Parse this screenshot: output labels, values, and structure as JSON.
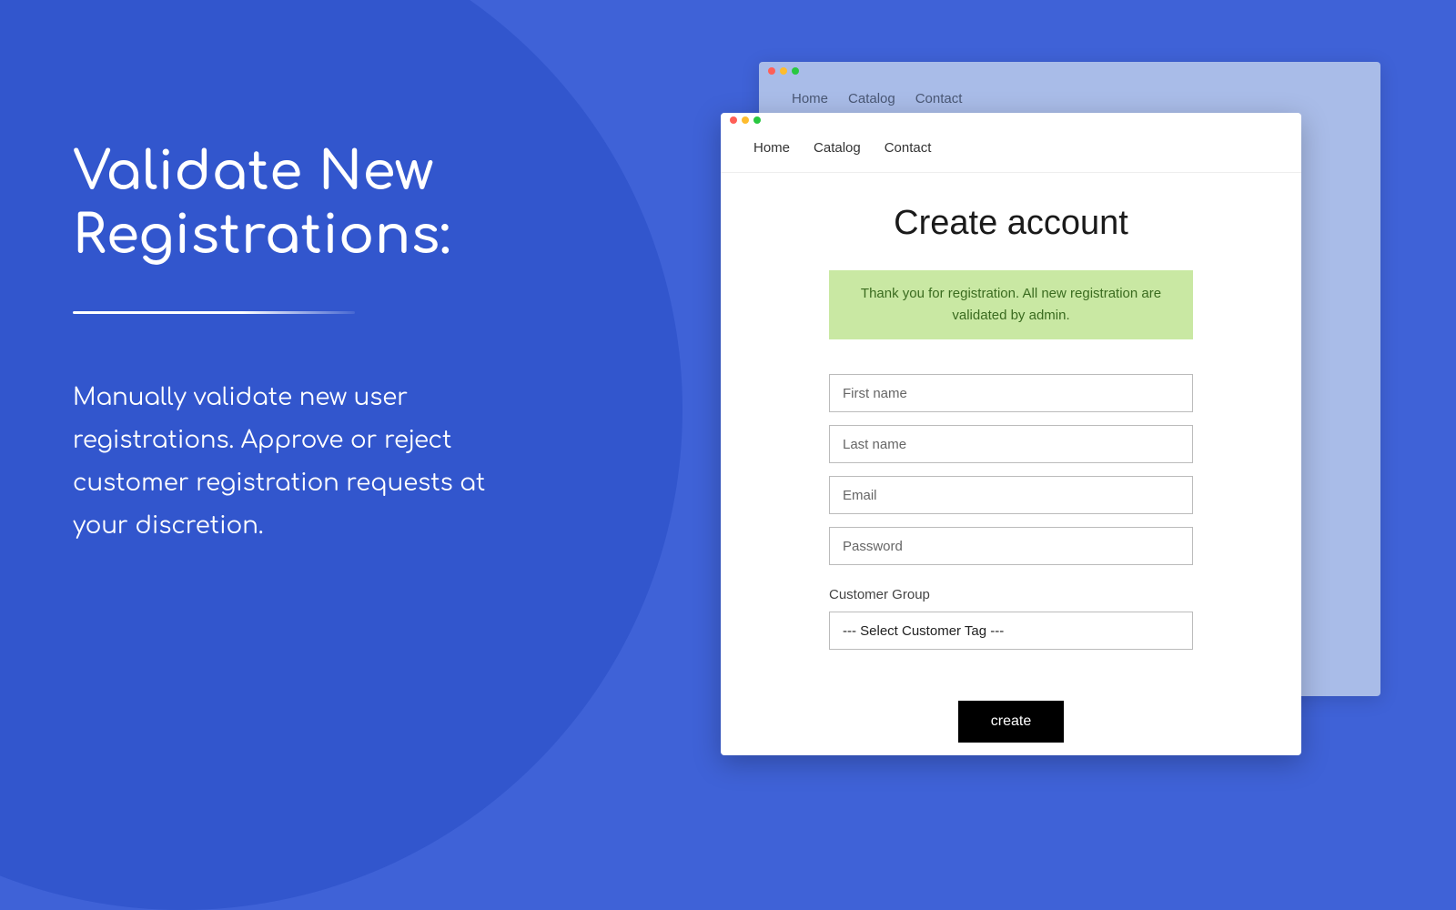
{
  "hero": {
    "heading_line1": "Validate New",
    "heading_line2": "Registrations:",
    "description": "Manually validate new user registrations. Approve or reject customer registration requests at your discretion."
  },
  "back_window": {
    "nav": [
      "Home",
      "Catalog",
      "Contact"
    ]
  },
  "front_window": {
    "nav": [
      "Home",
      "Catalog",
      "Contact"
    ],
    "form": {
      "title": "Create account",
      "alert": "Thank you for registration. All new registration are validated by admin.",
      "fields": {
        "first_name": "First name",
        "last_name": "Last name",
        "email": "Email",
        "password": "Password"
      },
      "group_label": "Customer Group",
      "group_select": "--- Select Customer Tag ---",
      "submit": "create"
    }
  }
}
